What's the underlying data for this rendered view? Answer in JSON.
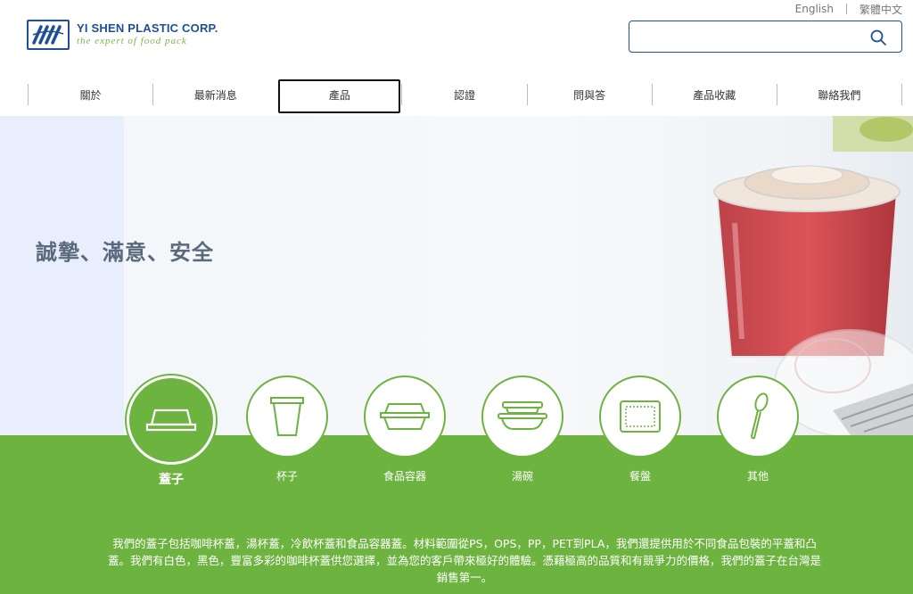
{
  "lang": {
    "english": "English",
    "chinese": "繁體中文"
  },
  "logo": {
    "name": "YI SHEN PLASTIC CORP.",
    "tagline": "the expert of food pack"
  },
  "search": {
    "placeholder": ""
  },
  "nav": [
    {
      "label": "關於"
    },
    {
      "label": "最新消息"
    },
    {
      "label": "產品"
    },
    {
      "label": "認證"
    },
    {
      "label": "問與答"
    },
    {
      "label": "產品收藏"
    },
    {
      "label": "聯絡我們"
    }
  ],
  "hero": {
    "title": "誠摯、滿意、安全"
  },
  "categories": [
    {
      "label": "蓋子",
      "icon": "lid-icon"
    },
    {
      "label": "杯子",
      "icon": "cup-icon"
    },
    {
      "label": "食品容器",
      "icon": "food-container-icon"
    },
    {
      "label": "湯碗",
      "icon": "soup-bowl-icon"
    },
    {
      "label": "餐盤",
      "icon": "tray-icon"
    },
    {
      "label": "其他",
      "icon": "spoon-icon"
    }
  ],
  "description": "我們的蓋子包括咖啡杯蓋，湯杯蓋，冷飲杯蓋和食品容器蓋。材料範圍從PS，OPS，PP，PET到PLA，我們還提供用於不同食品包裝的平蓋和凸蓋。我們有白色，黑色，豐富多彩的咖啡杯蓋供您選擇，並為您的客戶帶來極好的體驗。憑藉極高的品質和有競爭力的價格，我們的蓋子在台灣是銷售第一。",
  "colors": {
    "brand_blue": "#1f4f96",
    "brand_green": "#6db33f"
  }
}
